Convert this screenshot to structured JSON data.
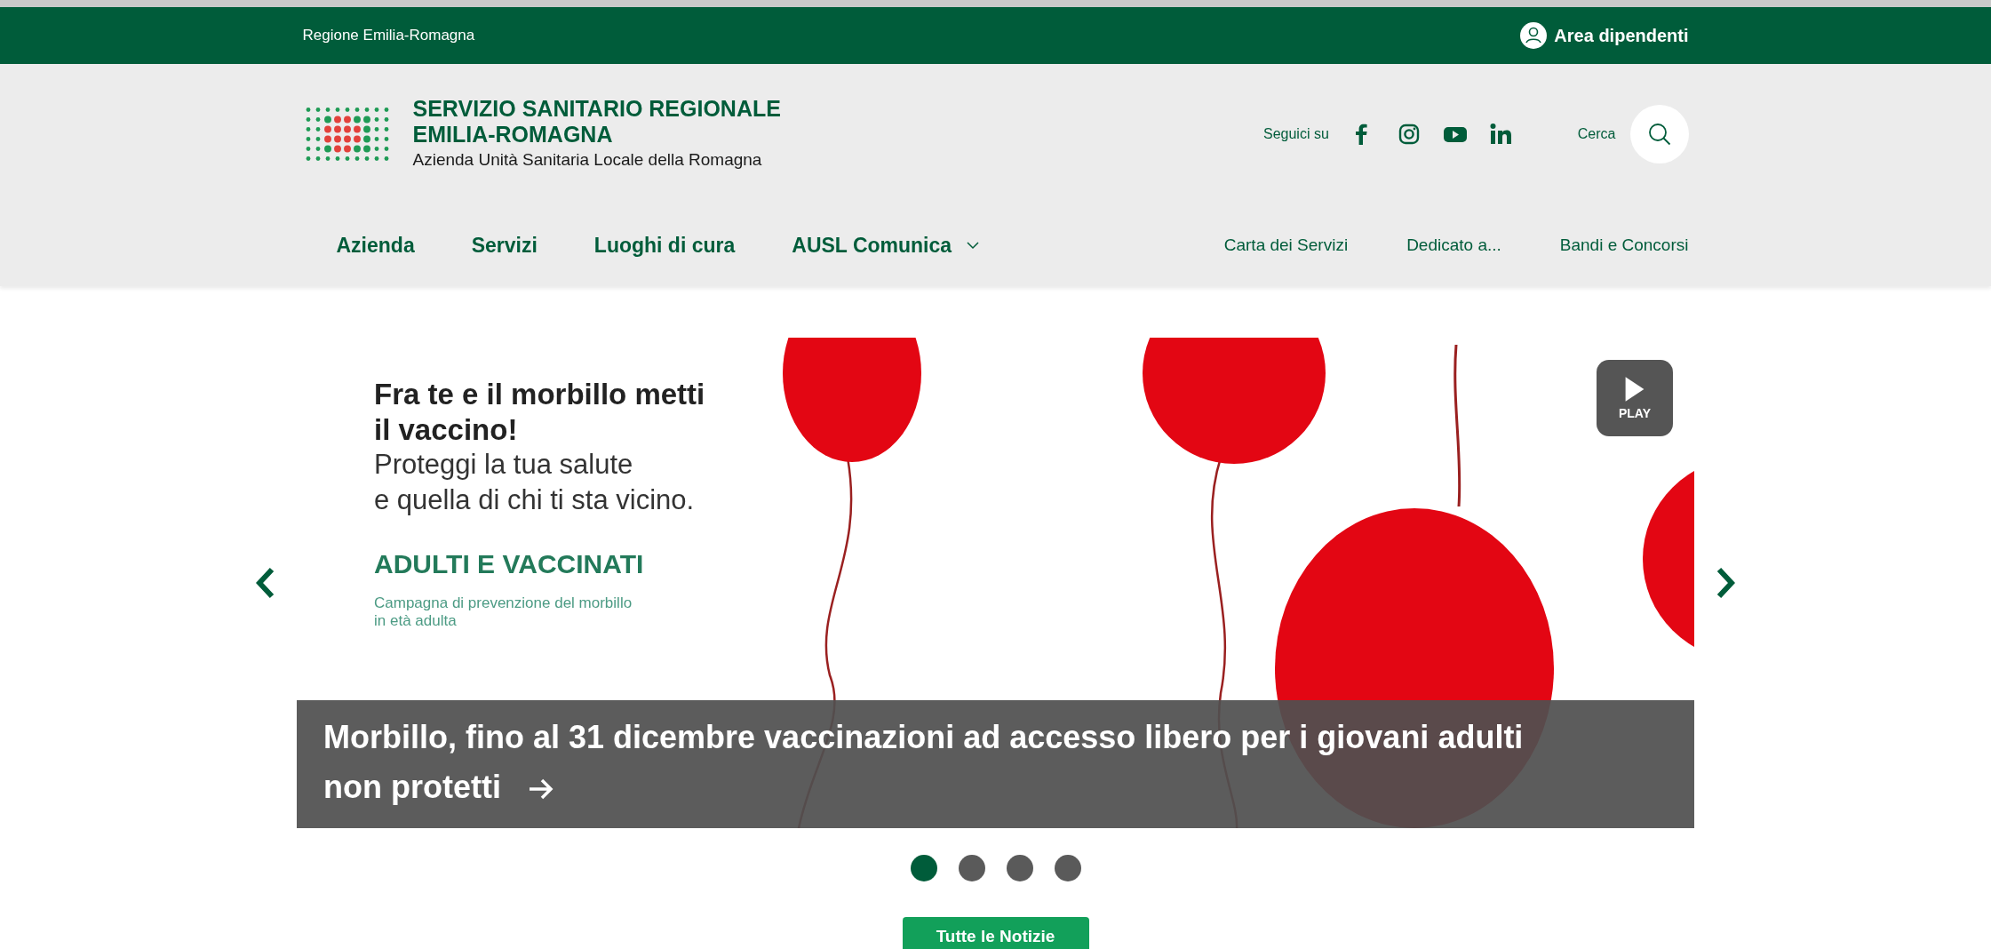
{
  "top_bar": {
    "region": "Regione Emilia-Romagna",
    "staff_area": "Area dipendenti"
  },
  "brand": {
    "title_lines": [
      "SERVIZIO SANITARIO REGIONALE",
      "EMILIA-ROMAGNA"
    ],
    "subtitle": "Azienda Unità Sanitaria Locale della Romagna"
  },
  "social": {
    "label": "Seguici su",
    "networks": [
      {
        "kind": "facebook"
      },
      {
        "kind": "instagram"
      },
      {
        "kind": "youtube"
      },
      {
        "kind": "linkedin"
      }
    ]
  },
  "search": {
    "label": "Cerca"
  },
  "main_nav": [
    {
      "label": "Azienda",
      "dropdown": false
    },
    {
      "label": "Servizi",
      "dropdown": false
    },
    {
      "label": "Luoghi di cura",
      "dropdown": false
    },
    {
      "label": "AUSL Comunica",
      "dropdown": true
    }
  ],
  "secondary_nav": [
    "Carta dei Servizi",
    "Dedicato a...",
    "Bandi e Concorsi"
  ],
  "slider": {
    "banner": {
      "headline_lines": [
        "Fra te e il morbillo metti",
        "il vaccino!"
      ],
      "body_lines": [
        "Proteggi la tua salute",
        "e quella di chi ti sta vicino."
      ],
      "campaign": "ADULTI E VACCINATI",
      "note_lines": [
        "Campagna di prevenzione del morbillo",
        "in età adulta"
      ]
    },
    "play_label": "PLAY",
    "caption": "Morbillo, fino al 31 dicembre vaccinazioni ad accesso libero per i giovani adulti non protetti",
    "dots": [
      {
        "selected": true
      },
      {
        "selected": false
      },
      {
        "selected": false
      },
      {
        "selected": false
      }
    ]
  },
  "all_news_button": "Tutte le Notizie"
}
